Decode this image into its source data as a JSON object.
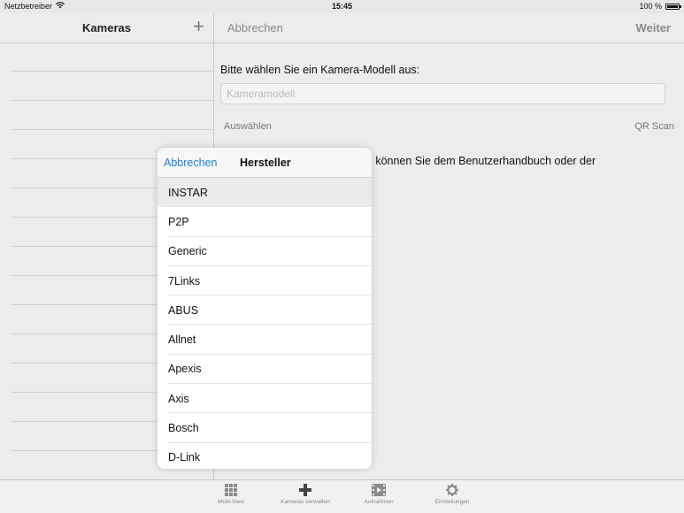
{
  "status_bar": {
    "carrier": "Netzbetreiber",
    "time": "15:45",
    "battery": "100 %"
  },
  "left_panel": {
    "title": "Kameras",
    "add_icon": "plus-icon"
  },
  "right_panel": {
    "cancel_label": "Abbrechen",
    "next_label": "Weiter",
    "prompt": "Bitte wählen Sie ein Kamera-Modell aus:",
    "model_placeholder": "Kameramodell",
    "select_label": "Auswählen",
    "qr_label": "QR Scan",
    "info_text": "ung können Sie dem Benutzerhandbuch oder der"
  },
  "popover": {
    "cancel_label": "Abbrechen",
    "title": "Hersteller",
    "selected": "INSTAR",
    "items": [
      "INSTAR",
      "P2P",
      "Generic",
      "7Links",
      "ABUS",
      "Allnet",
      "Apexis",
      "Axis",
      "Bosch",
      "D-Link"
    ]
  },
  "tabbar": {
    "tabs": [
      {
        "label": "Multi-View",
        "icon": "grid-icon"
      },
      {
        "label": "Kameras verwalten",
        "icon": "plus-icon"
      },
      {
        "label": "Aufnahmen",
        "icon": "film-icon"
      },
      {
        "label": "Einstellungen",
        "icon": "gear-icon"
      }
    ],
    "active_index": 1
  },
  "colors": {
    "accent": "#1a7fe3",
    "background": "#ececec"
  }
}
